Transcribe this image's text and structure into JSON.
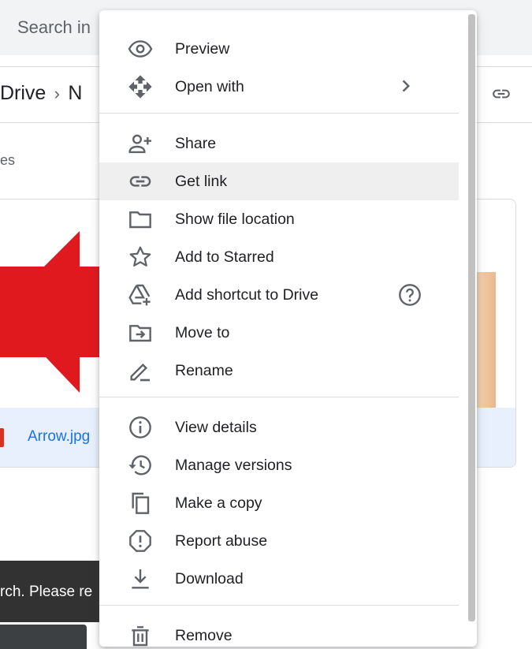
{
  "search": {
    "placeholder": "Search in"
  },
  "breadcrumb": {
    "root": "Drive",
    "chevron": "›",
    "current": "N"
  },
  "section_label": "es",
  "file": {
    "name": "Arrow.jpg"
  },
  "toast": {
    "text": "rch. Please re"
  },
  "colors": {
    "icon": "#5f6368",
    "hover": "#efefef",
    "link": "#1a73e8",
    "arrow": "#e0191f"
  },
  "menu": {
    "groups": [
      {
        "items": [
          {
            "label": "Preview",
            "icon": "eye-icon"
          },
          {
            "label": "Open with",
            "icon": "move-arrows-icon",
            "trailing": "chevron-right-icon"
          }
        ]
      },
      {
        "items": [
          {
            "label": "Share",
            "icon": "person-add-icon"
          },
          {
            "label": "Get link",
            "icon": "link-icon",
            "hovered": true
          },
          {
            "label": "Show file location",
            "icon": "folder-icon"
          },
          {
            "label": "Add to Starred",
            "icon": "star-icon"
          },
          {
            "label": "Add shortcut to Drive",
            "icon": "drive-shortcut-icon",
            "trailing": "help-icon"
          },
          {
            "label": "Move to",
            "icon": "move-to-folder-icon"
          },
          {
            "label": "Rename",
            "icon": "pencil-icon"
          }
        ]
      },
      {
        "items": [
          {
            "label": "View details",
            "icon": "info-icon"
          },
          {
            "label": "Manage versions",
            "icon": "history-icon"
          },
          {
            "label": "Make a copy",
            "icon": "copy-icon"
          },
          {
            "label": "Report abuse",
            "icon": "report-icon"
          },
          {
            "label": "Download",
            "icon": "download-icon"
          }
        ]
      },
      {
        "items": [
          {
            "label": "Remove",
            "icon": "trash-icon"
          }
        ]
      }
    ]
  }
}
